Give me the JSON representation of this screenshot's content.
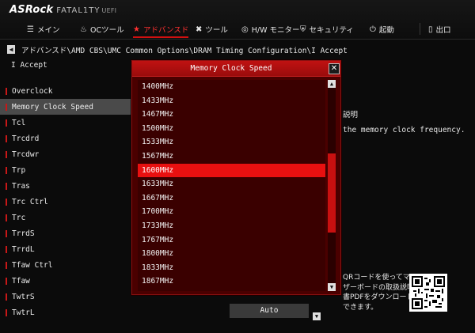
{
  "header": {
    "logo_brand": "ASRock",
    "logo_sub": "FATAL1TY",
    "logo_uefi": "UEFI",
    "tabs": [
      {
        "label": "メイン",
        "icon": "list-icon"
      },
      {
        "label": "OCツール",
        "icon": "flame-icon"
      },
      {
        "label": "アドバンスド",
        "icon": "star-icon"
      },
      {
        "label": "ツール",
        "icon": "tools-icon"
      },
      {
        "label": "H/W モニター",
        "icon": "gauge-icon"
      },
      {
        "label": "セキュリティ",
        "icon": "shield-icon"
      },
      {
        "label": "起動",
        "icon": "power-icon"
      },
      {
        "label": "出口",
        "icon": "exit-icon"
      }
    ],
    "active_tab": "アドバンスド",
    "accent_color": "#d01010"
  },
  "breadcrumb": {
    "text": "アドバンスド\\AMD CBS\\UMC Common Options\\DRAM Timing Configuration\\I Accept"
  },
  "accept_label": "I Accept",
  "settings": [
    "Overclock",
    "Memory Clock Speed",
    "Tcl",
    "Trcdrd",
    "Trcdwr",
    "Trp",
    "Tras",
    "Trc Ctrl",
    "Trc",
    "TrrdS",
    "TrrdL",
    "Tfaw Ctrl",
    "Tfaw",
    "TwtrS",
    "TwtrL"
  ],
  "selected_setting": "Memory Clock Speed",
  "help": {
    "title": "説明",
    "description": "the memory clock frequency."
  },
  "qr": {
    "text": "QRコードを使ってマザーボードの取扱説明書PDFをダウンロードできます。"
  },
  "value_field": {
    "value": "Auto",
    "ghost": "Auto"
  },
  "popup": {
    "title": "Memory Clock Speed",
    "close_label": "✕",
    "options": [
      "1400MHz",
      "1433MHz",
      "1467MHz",
      "1500MHz",
      "1533MHz",
      "1567MHz",
      "1600MHz",
      "1633MHz",
      "1667MHz",
      "1700MHz",
      "1733MHz",
      "1767MHz",
      "1800MHz",
      "1833MHz",
      "1867MHz"
    ],
    "selected": "1600MHz",
    "highlight_color": "#e81010"
  }
}
